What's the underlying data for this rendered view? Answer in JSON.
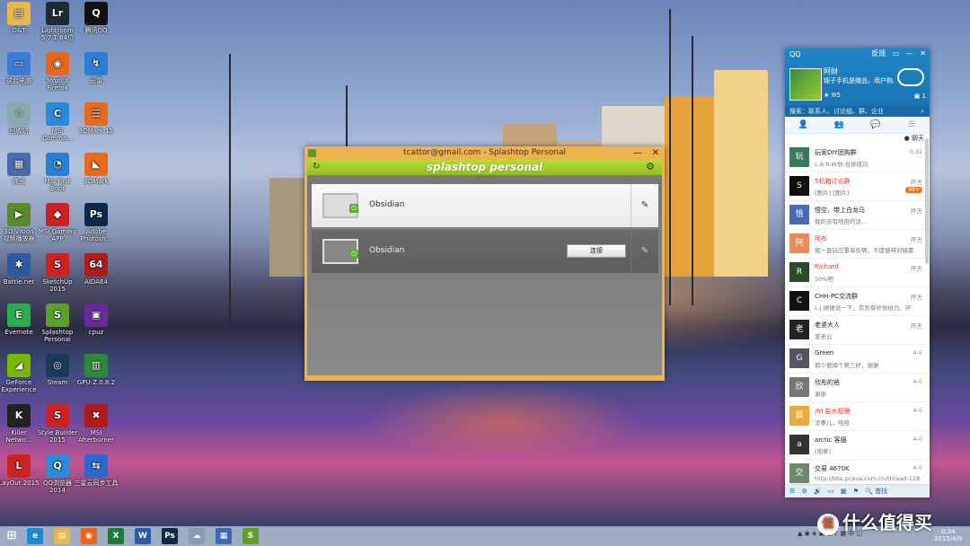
{
  "desktop": {
    "icons": [
      {
        "label": "D&T",
        "glyph": "▤",
        "color": "#e8b84a"
      },
      {
        "label": "Lightroom\n5.7.1 64位",
        "glyph": "Lr",
        "color": "#1f2a38"
      },
      {
        "label": "腾讯QQ",
        "glyph": "Q",
        "color": "#111"
      },
      {
        "label": "这台电脑",
        "glyph": "▭",
        "color": "#3a7bd5"
      },
      {
        "label": "Mozilla\nFirefox",
        "glyph": "◉",
        "color": "#e8661a"
      },
      {
        "label": "迅雷",
        "glyph": "↯",
        "color": "#2a7fd4"
      },
      {
        "label": "回收站",
        "glyph": "♲",
        "color": "#8aa"
      },
      {
        "label": "MSI\nComma...",
        "glyph": "C",
        "color": "#2a8ad8"
      },
      {
        "label": "3DMark 11",
        "glyph": "☰",
        "color": "#e86a1a"
      },
      {
        "label": "夜光",
        "glyph": "▦",
        "color": "#4a6ab0"
      },
      {
        "label": "MSI Fast\nBoot",
        "glyph": "◔",
        "color": "#2a7fd4"
      },
      {
        "label": "3DMark",
        "glyph": "◣",
        "color": "#e86a1a"
      },
      {
        "label": "3D Vision\n视频播放器",
        "glyph": "▶",
        "color": "#5a8a2a"
      },
      {
        "label": "MSI Gaming\nAPP",
        "glyph": "◆",
        "color": "#c22"
      },
      {
        "label": "Adobe\nPhotosh...",
        "glyph": "Ps",
        "color": "#0a2a4a"
      },
      {
        "label": "Battle.net",
        "glyph": "✱",
        "color": "#2a5aa0"
      },
      {
        "label": "SketchUp\n2015",
        "glyph": "S",
        "color": "#c22"
      },
      {
        "label": "AIDA64",
        "glyph": "64",
        "color": "#b01a1a"
      },
      {
        "label": "Evernote",
        "glyph": "E",
        "color": "#2ab04a"
      },
      {
        "label": "Splashtop\nPersonal",
        "glyph": "S",
        "color": "#5aa02a"
      },
      {
        "label": "cpuz",
        "glyph": "▣",
        "color": "#6a2a9a"
      },
      {
        "label": "GeForce\nExperience",
        "glyph": "◢",
        "color": "#76b900"
      },
      {
        "label": "Steam",
        "glyph": "◎",
        "color": "#1a3a5a"
      },
      {
        "label": "GPU-Z.0.8.2",
        "glyph": "▥",
        "color": "#2a8a3a"
      },
      {
        "label": "Killer\nNetwo...",
        "glyph": "K",
        "color": "#222"
      },
      {
        "label": "Style Builder\n2015",
        "glyph": "S",
        "color": "#c22"
      },
      {
        "label": "MSI\nAfterburner",
        "glyph": "✖",
        "color": "#b01a1a"
      },
      {
        "label": "LayOut 2015",
        "glyph": "L",
        "color": "#c22"
      },
      {
        "label": "QQ浏览器\n2014",
        "glyph": "Q",
        "color": "#2a8ad8"
      },
      {
        "label": "三星云同步工具",
        "glyph": "⇆",
        "color": "#2a6ad0"
      }
    ]
  },
  "splashtop": {
    "title": "tcattor@gmail.com - Splashtop Personal",
    "brand": "splashtop personal",
    "devices": [
      {
        "name": "Obsidian"
      },
      {
        "name": "Obsidian",
        "connect_label": "连接"
      }
    ]
  },
  "qq": {
    "title": "QQ",
    "top_btns": [
      "反馈",
      "▭",
      "—",
      "✕"
    ],
    "nickname": "阿财",
    "signature": "锦子手机是赠品，用户购...",
    "mail_count": "5",
    "msg_count": "1",
    "search_placeholder": "搜索：联系人、讨论组、群、企业",
    "tabs": [
      "👤",
      "👥",
      "💬",
      "☰"
    ],
    "subbar": "聊天",
    "chats": [
      {
        "name": "玩家DIY团购群",
        "msg": "L.A.R.W你:合体成功",
        "time": "0:32",
        "red": false,
        "color": "#3a7a5a",
        "glyph": "玩"
      },
      {
        "name": "5机箱讨论群",
        "msg": "[图片] [图片]",
        "time": "昨天",
        "badge": "99+",
        "red": true,
        "color": "#111",
        "glyph": "S"
      },
      {
        "name": "悟空，带上白龙马",
        "msg": "我的没有啥用的话...",
        "time": "昨天",
        "red": false,
        "color": "#4a6ab0",
        "glyph": "悟"
      },
      {
        "name": "阿布",
        "msg": "我一直玩应重单反啊，不遗憾啡对镜素",
        "time": "昨天",
        "red": true,
        "color": "#e88a5a",
        "glyph": "阿"
      },
      {
        "name": "Richard",
        "msg": "50%吧",
        "time": "昨天",
        "red": true,
        "color": "#2a4a2a",
        "glyph": "R"
      },
      {
        "name": "CHH-PC交流群",
        "msg": "L.J:顺便说一下，京东保修很给力。环",
        "time": "昨天",
        "red": false,
        "color": "#111",
        "glyph": "C"
      },
      {
        "name": "老婆大人",
        "msg": "爱老公",
        "time": "昨天",
        "red": false,
        "color": "#222",
        "glyph": "老"
      },
      {
        "name": "Green",
        "msg": "那少要择个第三好，谢谢",
        "time": "4-5",
        "red": false,
        "color": "#556",
        "glyph": "G"
      },
      {
        "name": "欣彤的爸",
        "msg": "谢谢",
        "time": "4-5",
        "red": false,
        "color": "#777",
        "glyph": "欣"
      },
      {
        "name": "/fd 盐水狐狸",
        "msg": "没事儿，哈哈",
        "time": "4-5",
        "red": true,
        "color": "#e8aa3a",
        "glyph": "狐"
      },
      {
        "name": "arctic 客服",
        "msg": "[抱拳]",
        "time": "4-5",
        "red": false,
        "color": "#333",
        "glyph": "a"
      },
      {
        "name": "交易 4670K",
        "msg": "http://bbs.pceva.com.cn/thread-118454-1",
        "time": "4-5",
        "red": false,
        "color": "#6a8a6a",
        "glyph": "交"
      }
    ],
    "footer": [
      "☰",
      "⚙",
      "🔊",
      "▭",
      "▦",
      "⚑",
      "🔍 查找"
    ]
  },
  "taskbar": {
    "apps": [
      {
        "glyph": "e",
        "color": "#1a8ad8"
      },
      {
        "glyph": "▤",
        "color": "#e8b84a"
      },
      {
        "glyph": "◉",
        "color": "#e8661a"
      },
      {
        "glyph": "X",
        "color": "#1f7a3a"
      },
      {
        "glyph": "W",
        "color": "#2a5aa8"
      },
      {
        "glyph": "Ps",
        "color": "#0a2a4a"
      },
      {
        "glyph": "☁",
        "color": "#8a9ab0"
      },
      {
        "glyph": "▦",
        "color": "#3a6ab0"
      },
      {
        "glyph": "S",
        "color": "#5aa02a"
      }
    ],
    "time": "0:34",
    "date": "2015/4/9"
  },
  "watermark": {
    "badge": "值",
    "text": "什么值得买"
  }
}
